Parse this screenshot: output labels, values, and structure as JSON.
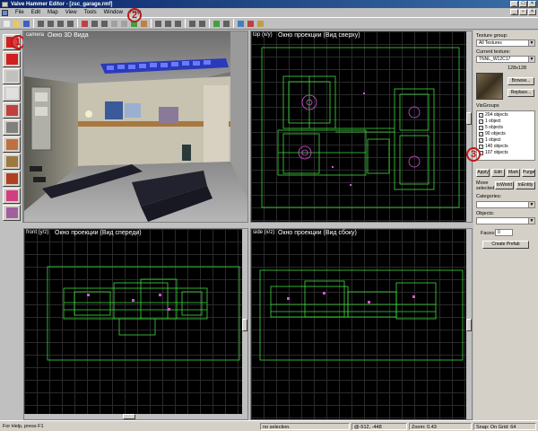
{
  "window": {
    "title": "Valve Hammer Editor - [zsc_garage.rmf]"
  },
  "menu": {
    "items": [
      "File",
      "Edit",
      "Map",
      "View",
      "Tools",
      "Window",
      "Help"
    ]
  },
  "annotations": {
    "badge_1": "1",
    "badge_2": "2",
    "badge_3": "3"
  },
  "viewports": {
    "camera": {
      "label": "camera",
      "caption": "Окно 3D Вида"
    },
    "top": {
      "label": "top (x/y)",
      "caption": "Окно проекции (Вид сверху)"
    },
    "front": {
      "label": "front (y/z)",
      "caption": "Окно проекции (Вид спереди)"
    },
    "side": {
      "label": "side (x/z)",
      "caption": "Окно проекции (Вид сбоку)"
    }
  },
  "texture_panel": {
    "group_label": "Texture group:",
    "group_value": "All Textures",
    "current_label": "Current texture:",
    "current_value": "TNNL_W12C17",
    "size": "128x128",
    "browse_label": "Browse...",
    "replace_label": "Replace..."
  },
  "visgroups": {
    "label": "VisGroups",
    "items": [
      "204 objects",
      "1 object",
      "5 objects",
      "90 objects",
      "1 object",
      "140 objects",
      "107 objects"
    ],
    "buttons": [
      "Apply",
      "Edit",
      "Mark",
      "Purge"
    ],
    "move_label": "Move selected:",
    "to_world": "toWorld",
    "to_entity": "toEntity",
    "categories_label": "Categories:",
    "objects_label": "Objects:",
    "faces_label": "Faces:",
    "faces_value": "0",
    "create_prefab": "Create Prefab"
  },
  "statusbar": {
    "help": "For Help, press F1",
    "selection": "no selection.",
    "coords": "@-512, -448",
    "zoom": "Zoom: 0.43",
    "snap": "Snap: On Grid: 64"
  },
  "colors": {
    "grid_line": "#2a2a2a",
    "brush_green": "#3cdc3c",
    "entity_magenta": "#dc50dc",
    "badge_red": "#c01818",
    "title_blue": "#0a246a"
  },
  "toolbar_icons": [
    "new-icon",
    "open-icon",
    "save-icon",
    "grid-toggle-icon",
    "grid-3d-icon",
    "grid-smaller-icon",
    "grid-larger-icon",
    "sphere-icon",
    "group-icon",
    "ungroup-icon",
    "hide-icon",
    "show-icon",
    "cordon-icon",
    "carve-icon",
    "cut-icon",
    "copy-icon",
    "paste-icon",
    "undo-icon",
    "redo-icon",
    "selection-icon",
    "texture-lock-icon",
    "run-map-icon",
    "entity-report-icon",
    "check-problems-icon"
  ],
  "tool_icons": [
    "selection-tool-icon",
    "magnify-tool-icon",
    "camera-tool-icon",
    "entity-tool-icon",
    "block-tool-icon",
    "texture-apply-icon",
    "apply-current-texture-icon",
    "decal-tool-icon",
    "clip-tool-icon",
    "vertex-tool-icon",
    "path-tool-icon"
  ]
}
